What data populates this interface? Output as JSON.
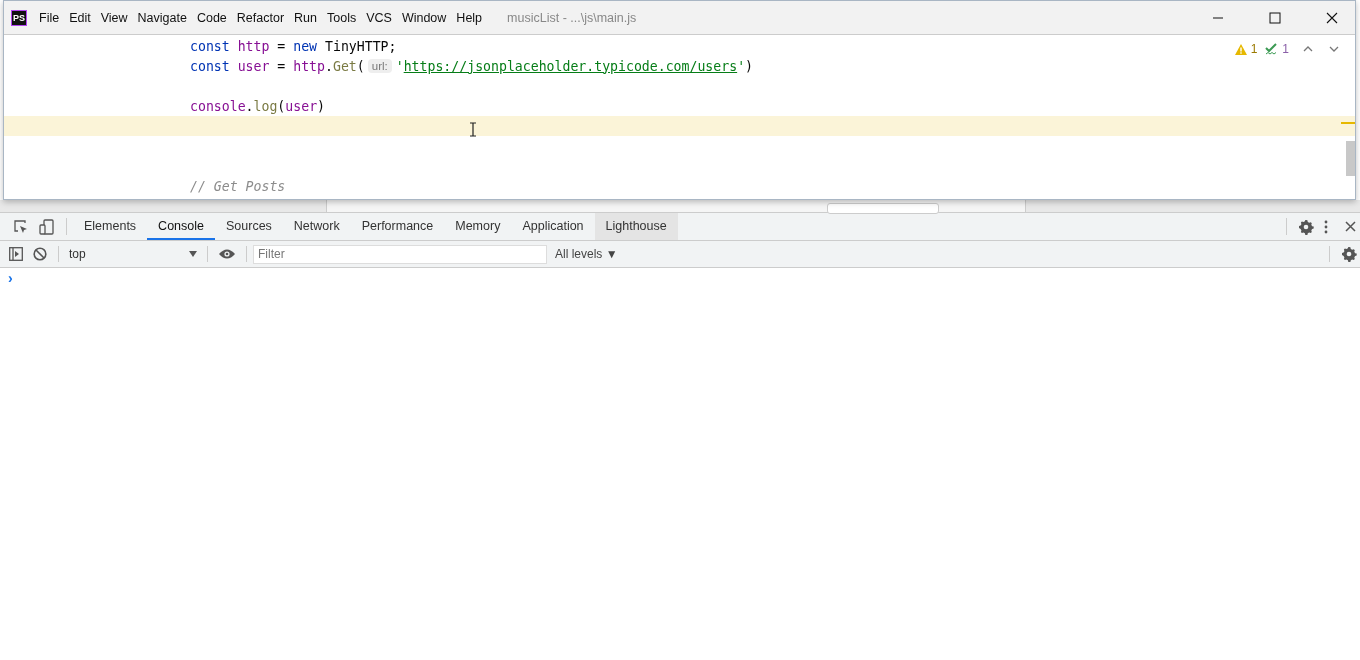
{
  "ide_window": {
    "logo": "PS",
    "menu": [
      {
        "label": "File"
      },
      {
        "label": "Edit"
      },
      {
        "label": "View"
      },
      {
        "label": "Navigate"
      },
      {
        "label": "Code"
      },
      {
        "label": "Refactor"
      },
      {
        "label": "Run"
      },
      {
        "label": "Tools"
      },
      {
        "label": "VCS"
      },
      {
        "label": "Window"
      },
      {
        "label": "Help"
      }
    ],
    "title": "musicList - ...\\js\\main.js",
    "inspections": {
      "warnings": "1",
      "weak_warnings": "1"
    },
    "code_lines": [
      {
        "current": false,
        "tokens": [
          {
            "kind": "keyword",
            "text": "const "
          },
          {
            "kind": "variable",
            "text": "http"
          },
          {
            "kind": "plain",
            "text": " = "
          },
          {
            "kind": "keyword",
            "text": "new"
          },
          {
            "kind": "plain",
            "text": " TinyHTTP;"
          }
        ]
      },
      {
        "current": false,
        "tokens": [
          {
            "kind": "keyword",
            "text": "const "
          },
          {
            "kind": "variable",
            "text": "user"
          },
          {
            "kind": "plain",
            "text": " = "
          },
          {
            "kind": "variable",
            "text": "http"
          },
          {
            "kind": "plain",
            "text": "."
          },
          {
            "kind": "function",
            "text": "Get"
          },
          {
            "kind": "plain",
            "text": "("
          },
          {
            "kind": "hint",
            "text": "url:"
          },
          {
            "kind": "string",
            "text": "'"
          },
          {
            "kind": "link",
            "text": "https://jsonplaceholder.typicode.com/users"
          },
          {
            "kind": "string",
            "text": "'"
          },
          {
            "kind": "plain",
            "text": ")"
          }
        ]
      },
      {
        "current": false
      },
      {
        "current": false,
        "tokens": [
          {
            "kind": "variable",
            "text": "console"
          },
          {
            "kind": "plain",
            "text": "."
          },
          {
            "kind": "function",
            "text": "log"
          },
          {
            "kind": "plain",
            "text": "("
          },
          {
            "kind": "variable",
            "text": "user"
          },
          {
            "kind": "plain",
            "text": ")"
          }
        ]
      },
      {
        "current": true
      },
      {
        "current": false
      },
      {
        "current": false
      },
      {
        "current": false,
        "tokens": [
          {
            "kind": "comment",
            "text": "// Get Posts"
          }
        ]
      }
    ]
  },
  "devtools": {
    "tabs": [
      {
        "label": "Elements",
        "selected": false,
        "hovered": false
      },
      {
        "label": "Console",
        "selected": true,
        "hovered": false
      },
      {
        "label": "Sources",
        "selected": false,
        "hovered": false
      },
      {
        "label": "Network",
        "selected": false,
        "hovered": false
      },
      {
        "label": "Performance",
        "selected": false,
        "hovered": false
      },
      {
        "label": "Memory",
        "selected": false,
        "hovered": false
      },
      {
        "label": "Application",
        "selected": false,
        "hovered": false
      },
      {
        "label": "Lighthouse",
        "selected": false,
        "hovered": true
      }
    ],
    "context": "top",
    "filter": {
      "placeholder": "Filter"
    },
    "levels": "All levels ▼",
    "prompt": "›"
  }
}
